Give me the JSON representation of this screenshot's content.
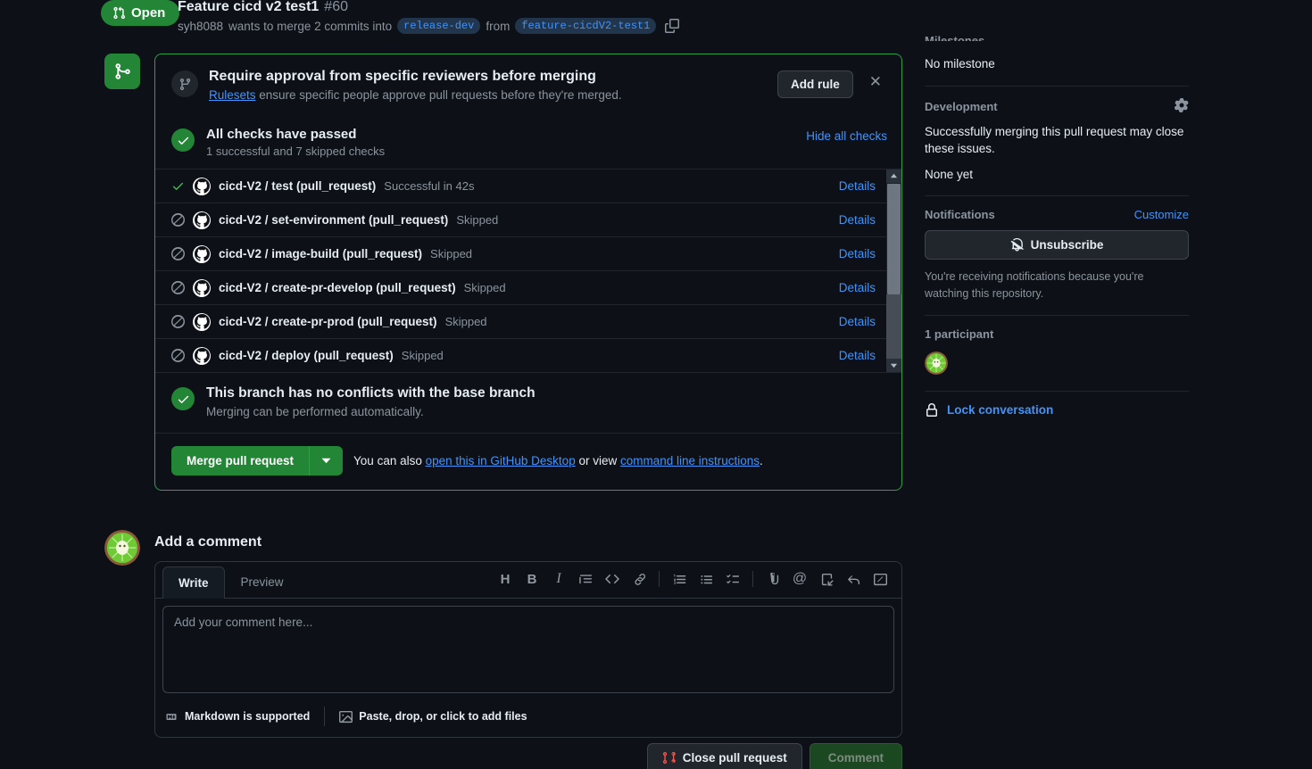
{
  "header": {
    "state_label": "Open",
    "state_icon": "pull-request-icon",
    "title": "Feature cicd v2 test1",
    "number": "#60",
    "author": "syh8088",
    "merge_text_1": "wants to merge 2 commits into",
    "base_branch": "release-dev",
    "merge_text_2": "from",
    "head_branch": "feature-cicdV2-test1",
    "copy_icon": "copy-icon"
  },
  "ruleset_banner": {
    "icon": "git-branch-icon",
    "title": "Require approval from specific reviewers before merging",
    "link_text": "Rulesets",
    "desc_rest": " ensure specific people approve pull requests before they're merged.",
    "add_rule_label": "Add rule",
    "close_icon": "close-icon"
  },
  "checks": {
    "title": "All checks have passed",
    "subtitle": "1 successful and 7 skipped checks",
    "hide_label": "Hide all checks",
    "details_label": "Details",
    "rows": [
      {
        "status": "success",
        "name": "cicd-V2 / test (pull_request)",
        "status_text": "Successful in 42s"
      },
      {
        "status": "skipped",
        "name": "cicd-V2 / set-environment (pull_request)",
        "status_text": "Skipped"
      },
      {
        "status": "skipped",
        "name": "cicd-V2 / image-build (pull_request)",
        "status_text": "Skipped"
      },
      {
        "status": "skipped",
        "name": "cicd-V2 / create-pr-develop (pull_request)",
        "status_text": "Skipped"
      },
      {
        "status": "skipped",
        "name": "cicd-V2 / create-pr-prod (pull_request)",
        "status_text": "Skipped"
      },
      {
        "status": "skipped",
        "name": "cicd-V2 / deploy (pull_request)",
        "status_text": "Skipped"
      }
    ]
  },
  "conflicts": {
    "title": "This branch has no conflicts with the base branch",
    "subtitle": "Merging can be performed automatically."
  },
  "merge": {
    "button_label": "Merge pull request",
    "caret_icon": "chevron-down-icon",
    "alt_prefix": "You can also ",
    "desktop_link": "open this in GitHub Desktop",
    "alt_middle": " or view ",
    "cli_link": "command line instructions",
    "alt_suffix": "."
  },
  "comment": {
    "heading": "Add a comment",
    "tab_write": "Write",
    "tab_preview": "Preview",
    "placeholder": "Add your comment here...",
    "markdown_note": "Markdown is supported",
    "attach_note": "Paste, drop, or click to add files",
    "toolbar": [
      {
        "name": "heading-icon",
        "glyph": "H"
      },
      {
        "name": "bold-icon",
        "glyph": "B"
      },
      {
        "name": "italic-icon",
        "glyph": "I"
      },
      {
        "name": "quote-icon",
        "glyph": "≡"
      },
      {
        "name": "code-icon",
        "glyph": "<>"
      },
      {
        "name": "link-icon",
        "glyph": "🔗"
      },
      {
        "name": "numbered-list-icon",
        "glyph": "1."
      },
      {
        "name": "bulleted-list-icon",
        "glyph": "•"
      },
      {
        "name": "task-list-icon",
        "glyph": "☑"
      },
      {
        "name": "attachment-icon",
        "glyph": "📎"
      },
      {
        "name": "mention-icon",
        "glyph": "@"
      },
      {
        "name": "saved-reply-icon",
        "glyph": "↗"
      },
      {
        "name": "reply-icon",
        "glyph": "↩"
      },
      {
        "name": "fullscreen-icon",
        "glyph": "↗"
      }
    ]
  },
  "bottom": {
    "close_pr_label": "Close pull request",
    "close_pr_icon": "pull-request-closed-icon",
    "comment_label": "Comment"
  },
  "sidebar": {
    "milestone_heading": "Milestones",
    "milestone_value": "No milestone",
    "development_heading": "Development",
    "development_gear": "gear-icon",
    "development_body": "Successfully merging this pull request may close these issues.",
    "development_none": "None yet",
    "notifications_heading": "Notifications",
    "customize_label": "Customize",
    "unsubscribe_label": "Unsubscribe",
    "unsubscribe_icon": "bell-slash-icon",
    "notifications_note": "You're receiving notifications because you're watching this repository.",
    "participants_heading": "1 participant",
    "lock_label": "Lock conversation",
    "lock_icon": "lock-icon"
  },
  "colors": {
    "open_green": "#238636",
    "link_blue": "#4493f8",
    "border_green": "#2f9e4f",
    "bg": "#0d1117"
  }
}
